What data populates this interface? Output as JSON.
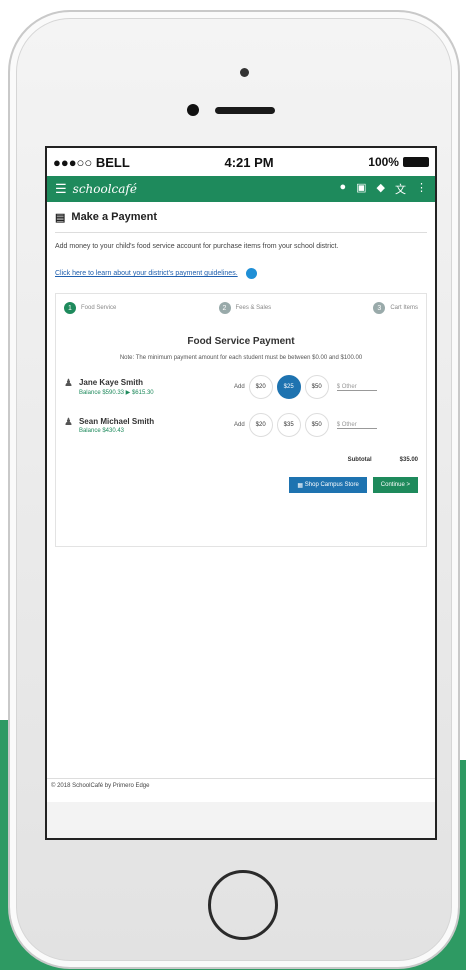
{
  "status_bar": {
    "carrier": "●●●○○ BELL",
    "time": "4:21 PM",
    "battery": "100%"
  },
  "app_bar": {
    "brand": "schoolcafé"
  },
  "page": {
    "title": "Make a Payment",
    "intro": "Add money to your child's food service account for purchase items from your school district.",
    "guidelines_link": "Click here to learn about your district's payment guidelines."
  },
  "steps": [
    {
      "number": "1",
      "label": "Food Service"
    },
    {
      "number": "2",
      "label": "Fees & Sales"
    },
    {
      "number": "3",
      "label": "Cart Items"
    }
  ],
  "payment": {
    "title": "Food Service Payment",
    "note": "Note: The minimum payment amount for each student must be between $0.00 and $100.00",
    "add_label": "Add",
    "other_placeholder": "$ Other",
    "students": [
      {
        "name": "Jane Kaye Smith",
        "balance": "Balance $590.33 ▶ $615.30",
        "amounts": [
          "$20",
          "$25",
          "$50"
        ],
        "selected": 1
      },
      {
        "name": "Sean Michael Smith",
        "balance": "Balance $430.43",
        "amounts": [
          "$20",
          "$35",
          "$50"
        ],
        "selected": -1
      }
    ],
    "subtotal_label": "Subtotal",
    "subtotal_value": "$35.00",
    "shop_button": "Shop Campus Store",
    "continue_button": "Continue >"
  },
  "footer": {
    "text": "© 2018 SchoolCafé by Primero Edge"
  },
  "colors": {
    "accent_green": "#1e8a5c",
    "selected_blue": "#1e73b0"
  }
}
